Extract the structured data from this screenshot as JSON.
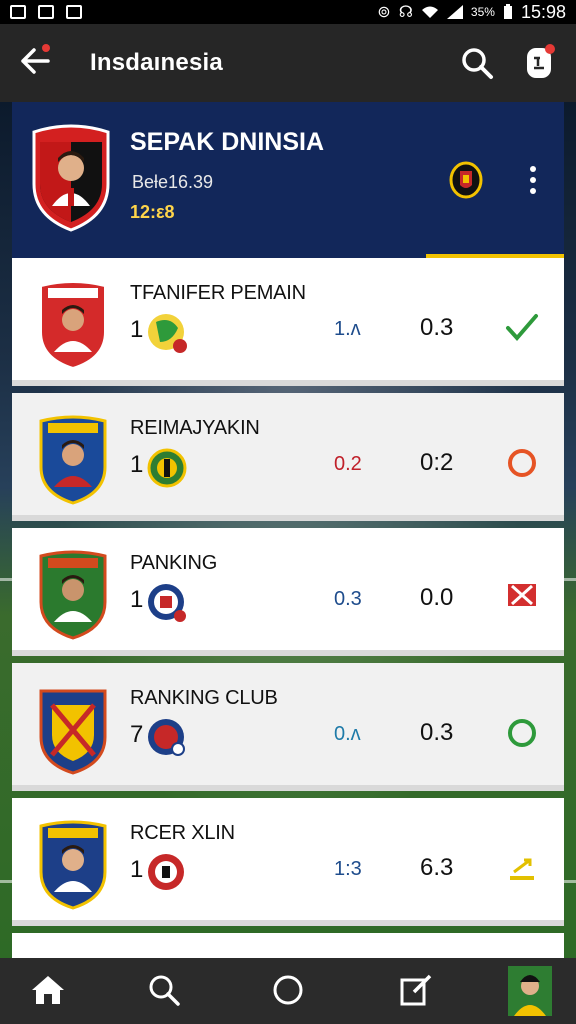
{
  "status_bar": {
    "time": "15:98",
    "battery": "35%",
    "icons": [
      "image-icon",
      "photo-icon",
      "gallery-icon",
      "alarm-icon",
      "headset-icon",
      "wifi-icon",
      "signal-icon",
      "battery-icon"
    ]
  },
  "app_bar": {
    "title": "Insdaınesia",
    "icons": [
      "back-arrow-icon",
      "search-icon",
      "profile-icon"
    ]
  },
  "header": {
    "title": "SEPAK DNINSIA",
    "subtitle": "Beƚe16.39",
    "time": "12:ε8",
    "accent_color": "#f2c200",
    "background_color": "#12275a"
  },
  "rows": [
    {
      "name": "TFANIFER PEMAIN",
      "num": "1",
      "val1": "1.ʌ",
      "val1_color": "#1e4c8c",
      "val2": "0.3",
      "status_icon": "check-icon",
      "status_color": "#2e9a3b",
      "badge_color": "#d42a2a"
    },
    {
      "name": "REIMAJYAKIN",
      "num": "1",
      "val1": "0.2",
      "val1_color": "#c0202a",
      "val2": "0:2",
      "status_icon": "circle-icon",
      "status_color": "#e65425",
      "badge_color": "#1a4a9a"
    },
    {
      "name": "PANKING",
      "num": "1",
      "val1": "0.3",
      "val1_color": "#1e4c8c",
      "val2": "0.0",
      "status_icon": "cross-flag-icon",
      "status_color": "#d32f2f",
      "badge_color": "#2b7a2e"
    },
    {
      "name": "RANKING CLUB",
      "num": "7",
      "val1": "0.ʌ",
      "val1_color": "#1e7aa8",
      "val2": "0.3",
      "status_icon": "ring-icon",
      "status_color": "#2e9a3b",
      "badge_color": "#d34a1e"
    },
    {
      "name": "RCER XLIN",
      "num": "1",
      "val1": "1:3",
      "val1_color": "#1e4c8c",
      "val2": "6.3",
      "status_icon": "arrow-flag-icon",
      "status_color": "#e2c000",
      "badge_color": "#1d3f88"
    }
  ],
  "bottom_nav": {
    "items": [
      "home-icon",
      "search-icon",
      "circle-icon",
      "edit-icon",
      "avatar-icon"
    ]
  }
}
